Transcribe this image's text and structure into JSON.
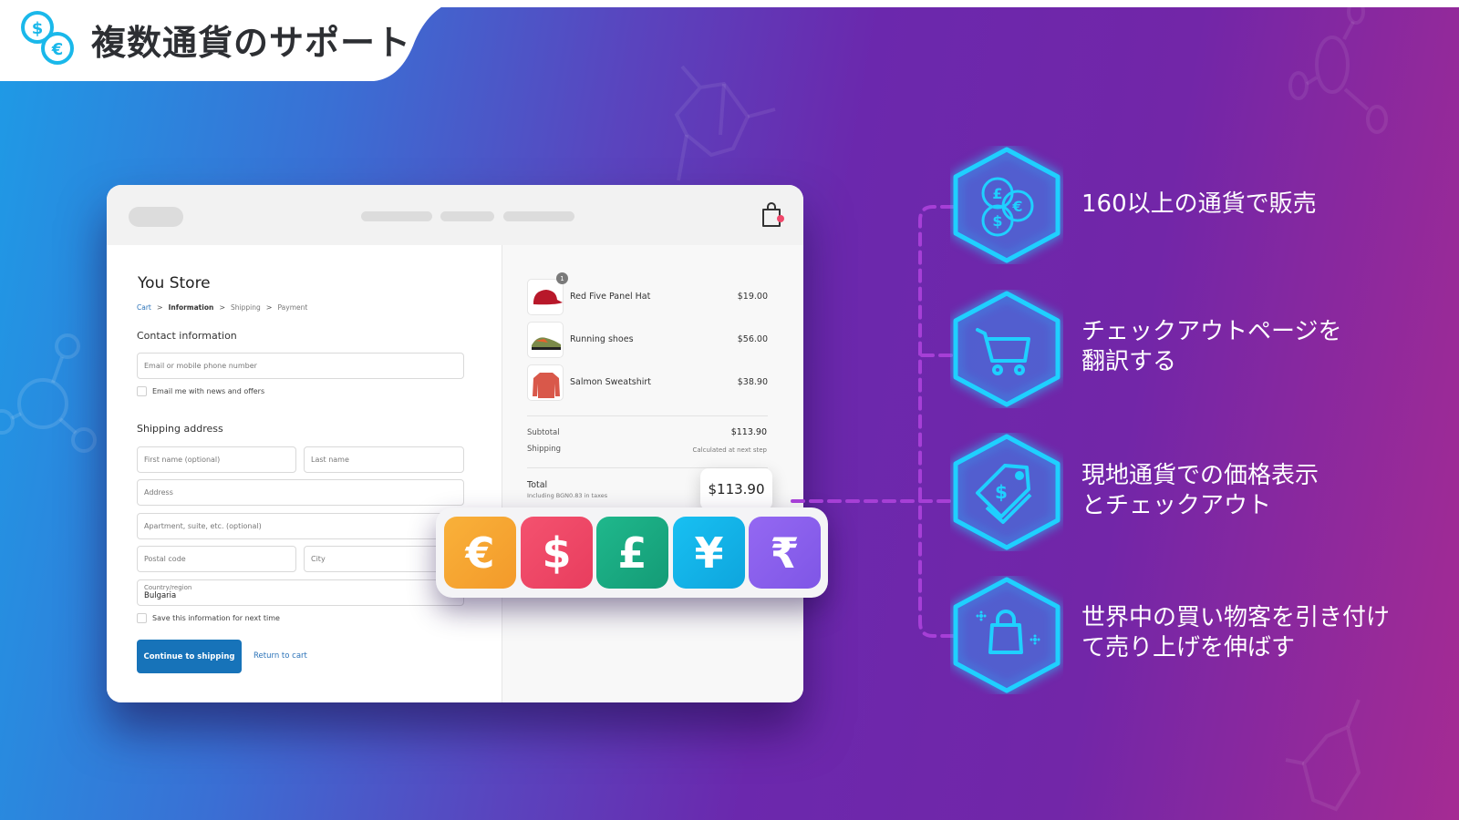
{
  "header": {
    "title": "複数通貨のサポート",
    "icon": "dollar-euro-coins-icon"
  },
  "colors": {
    "accent_cyan": "#1fd0ff",
    "dash_purple": "#a63fd6",
    "checkout_blue": "#1773b9",
    "euro_tile": "#f7a532",
    "dollar_tile": "#f0476a",
    "pound_tile": "#1aae86",
    "yen_tile": "#14b5ea",
    "rupee_tile": "#8a60ec"
  },
  "checkout": {
    "store_name": "You Store",
    "breadcrumb": [
      {
        "label": "Cart",
        "state": "link"
      },
      {
        "label": "Information",
        "state": "active"
      },
      {
        "label": "Shipping",
        "state": "inactive"
      },
      {
        "label": "Payment",
        "state": "inactive"
      }
    ],
    "breadcrumb_separator": ">",
    "contact_heading": "Contact information",
    "email_placeholder": "Email or mobile phone number",
    "email_opt_in_label": "Email me with news and offers",
    "shipping_heading": "Shipping address",
    "first_name_placeholder": "First name (optional)",
    "last_name_placeholder": "Last name",
    "address_placeholder": "Address",
    "apartment_placeholder": "Apartment, suite, etc. (optional)",
    "postal_placeholder": "Postal code",
    "city_placeholder": "City",
    "country_label": "Country/region",
    "country_value": "Bulgaria",
    "save_info_label": "Save this information for next time",
    "continue_button": "Continue to shipping",
    "return_link": "Return to cart"
  },
  "order_summary": {
    "cart_icon": "shopping-bag-icon",
    "items": [
      {
        "name": "Red Five Panel Hat",
        "price": "$19.00",
        "quantity": "1",
        "thumb": "red-cap-image"
      },
      {
        "name": "Running shoes",
        "price": "$56.00",
        "thumb": "sneaker-image"
      },
      {
        "name": "Salmon Sweatshirt",
        "price": "$38.90",
        "thumb": "sweatshirt-image"
      }
    ],
    "subtotal_label": "Subtotal",
    "subtotal_value": "$113.90",
    "shipping_label": "Shipping",
    "shipping_value": "Calculated at next step",
    "total_label": "Total",
    "total_taxes": "Including BGN0.83 in taxes",
    "total_value": "$113.90"
  },
  "currencies": [
    {
      "symbol": "€",
      "name": "euro"
    },
    {
      "symbol": "$",
      "name": "dollar"
    },
    {
      "symbol": "£",
      "name": "pound"
    },
    {
      "symbol": "¥",
      "name": "yen"
    },
    {
      "symbol": "₹",
      "name": "rupee"
    }
  ],
  "features": [
    {
      "icon": "coins-icon",
      "lines": [
        "160以上の通貨で販売"
      ]
    },
    {
      "icon": "shopping-cart-icon",
      "lines": [
        "チェックアウトページを",
        "翻訳する"
      ]
    },
    {
      "icon": "price-tag-icon",
      "lines": [
        "現地通貨での価格表示",
        "とチェックアウト"
      ]
    },
    {
      "icon": "shopping-bag-sparkle-icon",
      "lines": [
        "世界中の買い物客を引き付け",
        "て売り上げを伸ばす"
      ]
    }
  ]
}
